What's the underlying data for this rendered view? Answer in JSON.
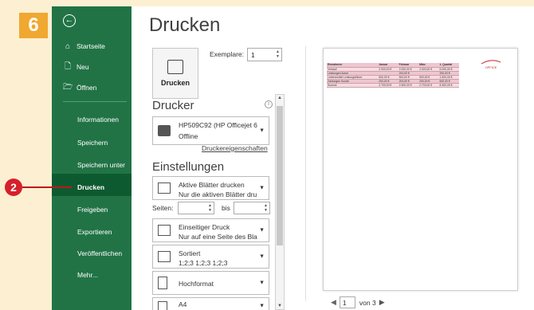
{
  "step_badges": {
    "top": "6",
    "side": "2"
  },
  "sidebar": {
    "back_label": "←",
    "items": [
      {
        "label": "Startseite",
        "icon": "home-icon",
        "glyph": "⌂"
      },
      {
        "label": "Neu",
        "icon": "new-file-icon",
        "glyph": "🗋"
      },
      {
        "label": "Öffnen",
        "icon": "folder-open-icon",
        "glyph": "🗁"
      }
    ],
    "text_items": [
      "Informationen",
      "Speichern",
      "Speichern unter",
      "Drucken",
      "Freigeben",
      "Exportieren",
      "Veröffentlichen",
      "Mehr..."
    ],
    "active": "Drucken"
  },
  "main": {
    "title": "Drucken",
    "print_button": "Drucken",
    "copies_label": "Exemplare:",
    "copies_value": "1",
    "printer_heading": "Drucker",
    "printer": {
      "name": "HP509C92 (HP Officejet 6...",
      "status": "Offline"
    },
    "printer_props_link": "Druckereigenschaften",
    "settings_heading": "Einstellungen",
    "settings": [
      {
        "line1": "Aktive Blätter drucken",
        "line2": "Nur die aktiven Blätter dru..."
      },
      {
        "line1": "Einseitiger Druck",
        "line2": "Nur auf eine Seite des Blat..."
      },
      {
        "line1": "Sortiert",
        "line2": "1;2;3   1;2;3   1;2;3"
      },
      {
        "line1": "Hochformat",
        "line2": ""
      },
      {
        "line1": "A4",
        "line2": ""
      }
    ],
    "pages_label": "Seiten:",
    "pages_to_label": "bis"
  },
  "preview": {
    "table": [
      [
        "Einnahmen",
        "Januar",
        "Februar",
        "März",
        "1. Quartal"
      ],
      [
        "Verkauf",
        "2.000,00 €",
        "2.000,00 €",
        "2.000,00 €",
        "6.000,00 €"
      ],
      [
        "Leistungen Acme",
        "",
        "200,00 €",
        "",
        "200,00 €"
      ],
      [
        "Lebensmittel Leistungsführer",
        "500,00 €",
        "500,00 €",
        "500,00 €",
        "1.500,00 €"
      ],
      [
        "Zahlungen Kunde",
        "200,00 €",
        "200,00 €",
        "200,00 €",
        "600,00 €"
      ],
      [
        "Summe",
        "2.700,00 €",
        "2.900,00 €",
        "2.700,00 €",
        "8.300,00 €"
      ]
    ],
    "logo_text": "OFFICE",
    "page_current": "1",
    "page_total_label": "von 3"
  },
  "colors": {
    "sidebar": "#217346",
    "sidebar_active": "#0e5a30",
    "badge_orange": "#f0a830",
    "badge_red": "#d6202b"
  }
}
